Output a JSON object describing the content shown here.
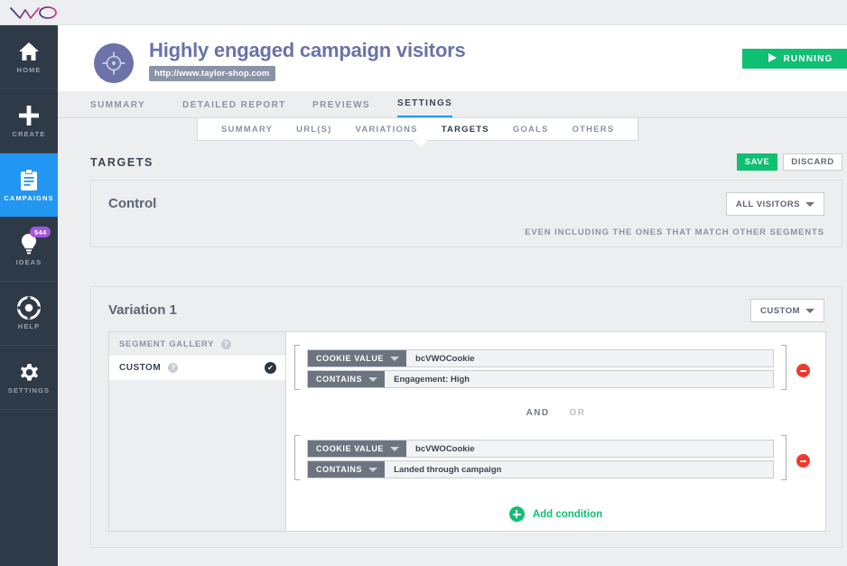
{
  "app": {
    "logo_alt": "vwo-logo"
  },
  "sidebar": {
    "items": [
      {
        "label": "HOME",
        "icon": "home-icon",
        "active": false,
        "badge": null
      },
      {
        "label": "CREATE",
        "icon": "plus-icon",
        "active": false,
        "badge": null
      },
      {
        "label": "CAMPAIGNS",
        "icon": "clipboard-icon",
        "active": true,
        "badge": null
      },
      {
        "label": "IDEAS",
        "icon": "lightbulb-icon",
        "active": false,
        "badge": "544"
      },
      {
        "label": "HELP",
        "icon": "lifebuoy-icon",
        "active": false,
        "badge": null
      },
      {
        "label": "SETTINGS",
        "icon": "gear-icon",
        "active": false,
        "badge": null
      }
    ]
  },
  "header": {
    "campaign_icon": "target-icon",
    "title": "Highly engaged campaign visitors",
    "url": "http://www.taylor-shop.com",
    "status_button": {
      "label": "RUNNING",
      "icon": "play-icon",
      "color": "#0fbf72"
    }
  },
  "primary_tabs": [
    {
      "label": "SUMMARY",
      "active": false
    },
    {
      "label": "DETAILED REPORT",
      "active": false
    },
    {
      "label": "PREVIEWS",
      "active": false
    },
    {
      "label": "SETTINGS",
      "active": true
    }
  ],
  "secondary_tabs": [
    {
      "label": "SUMMARY",
      "active": false
    },
    {
      "label": "URL(S)",
      "active": false
    },
    {
      "label": "VARIATIONS",
      "active": false
    },
    {
      "label": "TARGETS",
      "active": true
    },
    {
      "label": "GOALS",
      "active": false
    },
    {
      "label": "OTHERS",
      "active": false
    }
  ],
  "targets_bar": {
    "title": "TARGETS",
    "save_label": "SAVE",
    "discard_label": "DISCARD"
  },
  "control_card": {
    "title": "Control",
    "segment_dropdown": "ALL VISITORS",
    "note": "EVEN INCLUDING THE ONES THAT MATCH OTHER SEGMENTS"
  },
  "variation_card": {
    "title": "Variation 1",
    "segment_dropdown": "CUSTOM",
    "gallery": {
      "header": "SEGMENT GALLERY",
      "rows": [
        {
          "label": "CUSTOM",
          "selected": true
        }
      ]
    },
    "condition_groups": [
      {
        "attribute_dropdown": "COOKIE VALUE",
        "attribute_value": "bcVWOCookie",
        "operator_dropdown": "CONTAINS",
        "operator_value": "Engagement: High"
      },
      {
        "attribute_dropdown": "COOKIE VALUE",
        "attribute_value": "bcVWOCookie",
        "operator_dropdown": "CONTAINS",
        "operator_value": "Landed through campaign"
      }
    ],
    "joiner": {
      "and_label": "AND",
      "or_label": "OR",
      "selected": "AND"
    },
    "add_condition_label": "Add condition"
  },
  "colors": {
    "accent_blue": "#2196f3",
    "green": "#0fbf72",
    "red": "#f0392b",
    "purple": "#a259d9",
    "sidebar_dark": "#2f3a48",
    "title_purple": "#6b73a8"
  }
}
